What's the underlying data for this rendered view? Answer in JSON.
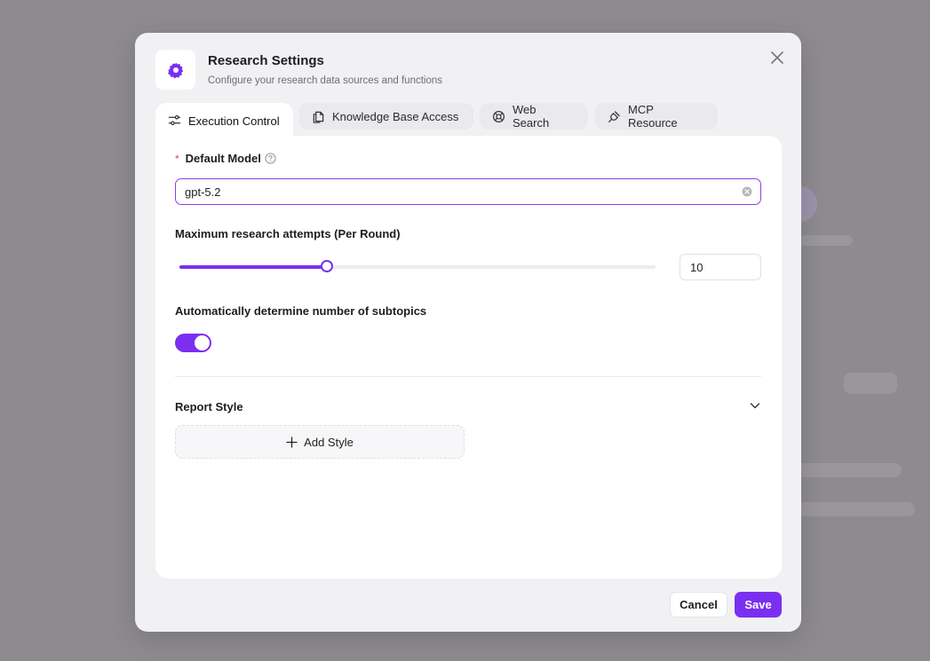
{
  "dialog": {
    "title": "Research Settings",
    "subtitle": "Configure your research data sources and functions",
    "accent_color": "#7b2ff0"
  },
  "tabs": [
    {
      "label": "Execution Control",
      "icon": "sliders-icon",
      "active": true
    },
    {
      "label": "Knowledge Base Access",
      "icon": "files-icon",
      "active": false
    },
    {
      "label": "Web Search",
      "icon": "lifebuoy-icon",
      "active": false
    },
    {
      "label": "MCP Resource",
      "icon": "plug-icon",
      "active": false
    }
  ],
  "execution": {
    "default_model_label": "Default Model",
    "required_marker": "*",
    "default_model_value": "gpt-5.2",
    "max_attempts_label": "Maximum research attempts (Per Round)",
    "max_attempts_value": "10",
    "slider_fraction": 0.31,
    "auto_subtopics_label": "Automatically determine number of subtopics",
    "auto_subtopics_on": true,
    "report_style_label": "Report Style",
    "add_style_label": "Add Style"
  },
  "footer": {
    "cancel_label": "Cancel",
    "save_label": "Save"
  }
}
